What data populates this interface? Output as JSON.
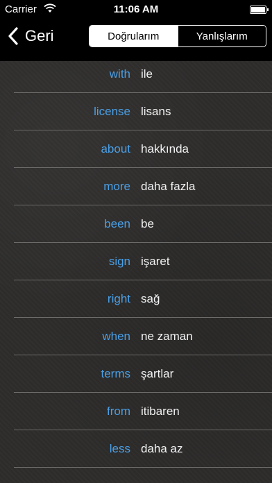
{
  "status_bar": {
    "carrier": "Carrier",
    "time": "11:06 AM"
  },
  "nav": {
    "back_label": "Geri",
    "segments": [
      "Doğrularım",
      "Yanlışlarım"
    ],
    "selected_segment": "Doğrularım"
  },
  "words": [
    {
      "en": "with",
      "tr": "ile"
    },
    {
      "en": "license",
      "tr": "lisans"
    },
    {
      "en": "about",
      "tr": "hakkında"
    },
    {
      "en": "more",
      "tr": "daha fazla"
    },
    {
      "en": "been",
      "tr": "be"
    },
    {
      "en": "sign",
      "tr": "işaret"
    },
    {
      "en": "right",
      "tr": "sağ"
    },
    {
      "en": "when",
      "tr": "ne zaman"
    },
    {
      "en": "terms",
      "tr": "şartlar"
    },
    {
      "en": "from",
      "tr": "itibaren"
    },
    {
      "en": "less",
      "tr": "daha az"
    }
  ],
  "colors": {
    "english_word": "#4a9fe6",
    "translation": "#f2f2f2",
    "header": "#000000",
    "background": "#2e2d2c"
  }
}
